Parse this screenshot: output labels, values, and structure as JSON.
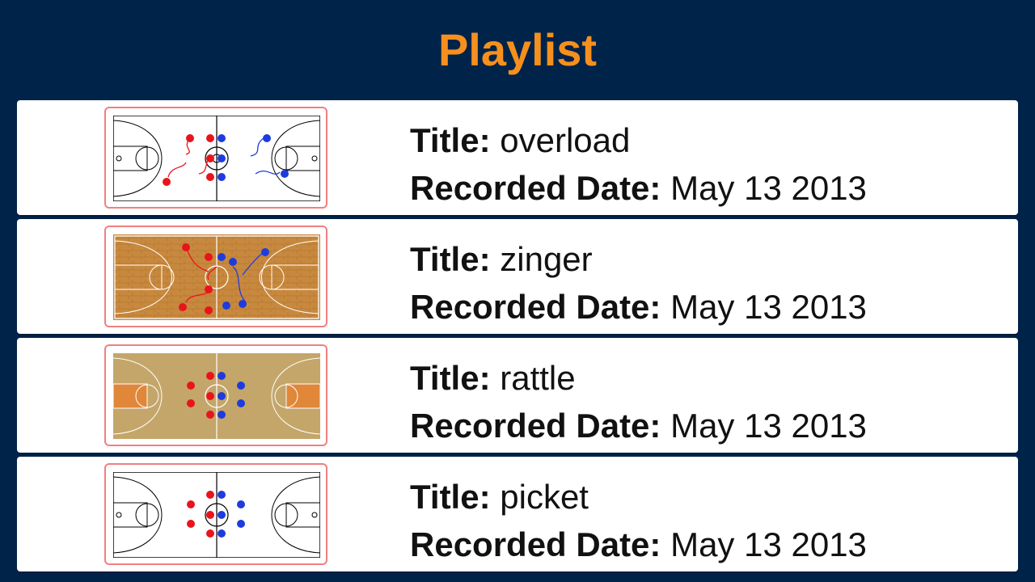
{
  "page_title": "Playlist",
  "labels": {
    "title": "Title:",
    "recorded_date": "Recorded Date:"
  },
  "items": [
    {
      "title": "overload",
      "recorded_date": "May 13 2013",
      "court_style": "white"
    },
    {
      "title": "zinger",
      "recorded_date": "May 13 2013",
      "court_style": "hardwood"
    },
    {
      "title": "rattle",
      "recorded_date": "May 13 2013",
      "court_style": "tan"
    },
    {
      "title": "picket",
      "recorded_date": "May 13 2013",
      "court_style": "white"
    }
  ],
  "colors": {
    "background": "#00234a",
    "title": "#f5901e",
    "card": "#ffffff",
    "thumb_border": "#f08080",
    "offense_player": "#e8141c",
    "defense_player": "#1e3cdc"
  }
}
